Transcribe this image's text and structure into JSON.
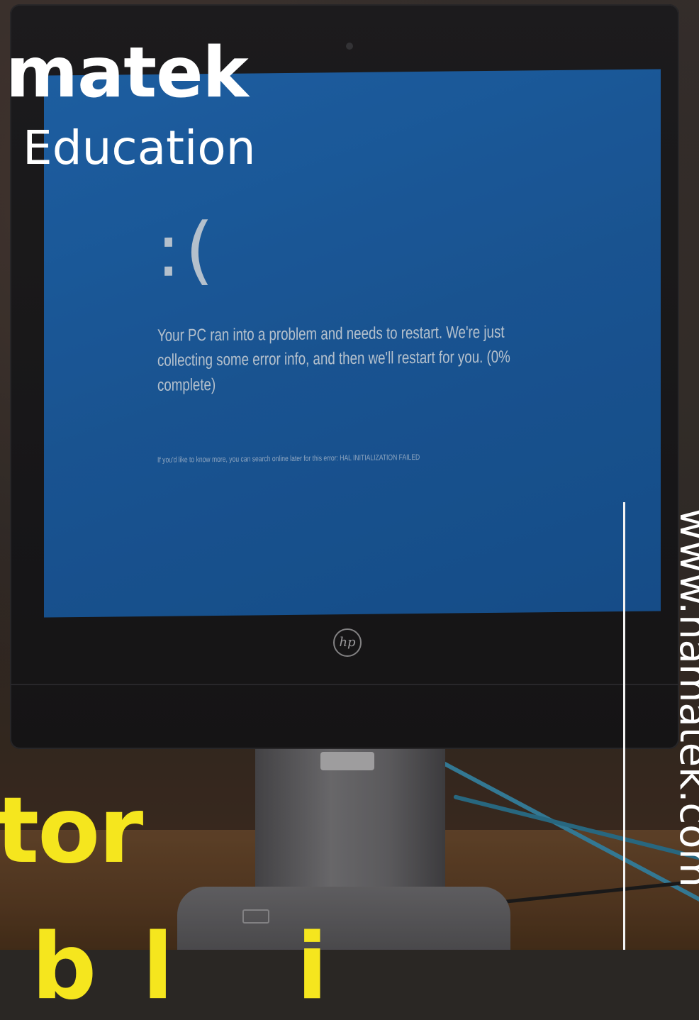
{
  "brand": {
    "name": "matek",
    "subtitle": "Education",
    "website": "www.hamatek.com"
  },
  "screen": {
    "sad_face": ":(",
    "message": "Your PC ran into a problem and needs to restart. We're just collecting some error info, and then we'll restart for you. (0% complete)",
    "detail": "If you'd like to know more, you can search online later for this error: HAL INITIALIZATION FAILED"
  },
  "headline": {
    "line1": "tor",
    "line2": " b l   i"
  },
  "monitor": {
    "logo": "hp"
  },
  "colors": {
    "accent_yellow": "#f5e61e",
    "bsod_blue": "#1a62ad",
    "white": "#ffffff"
  }
}
